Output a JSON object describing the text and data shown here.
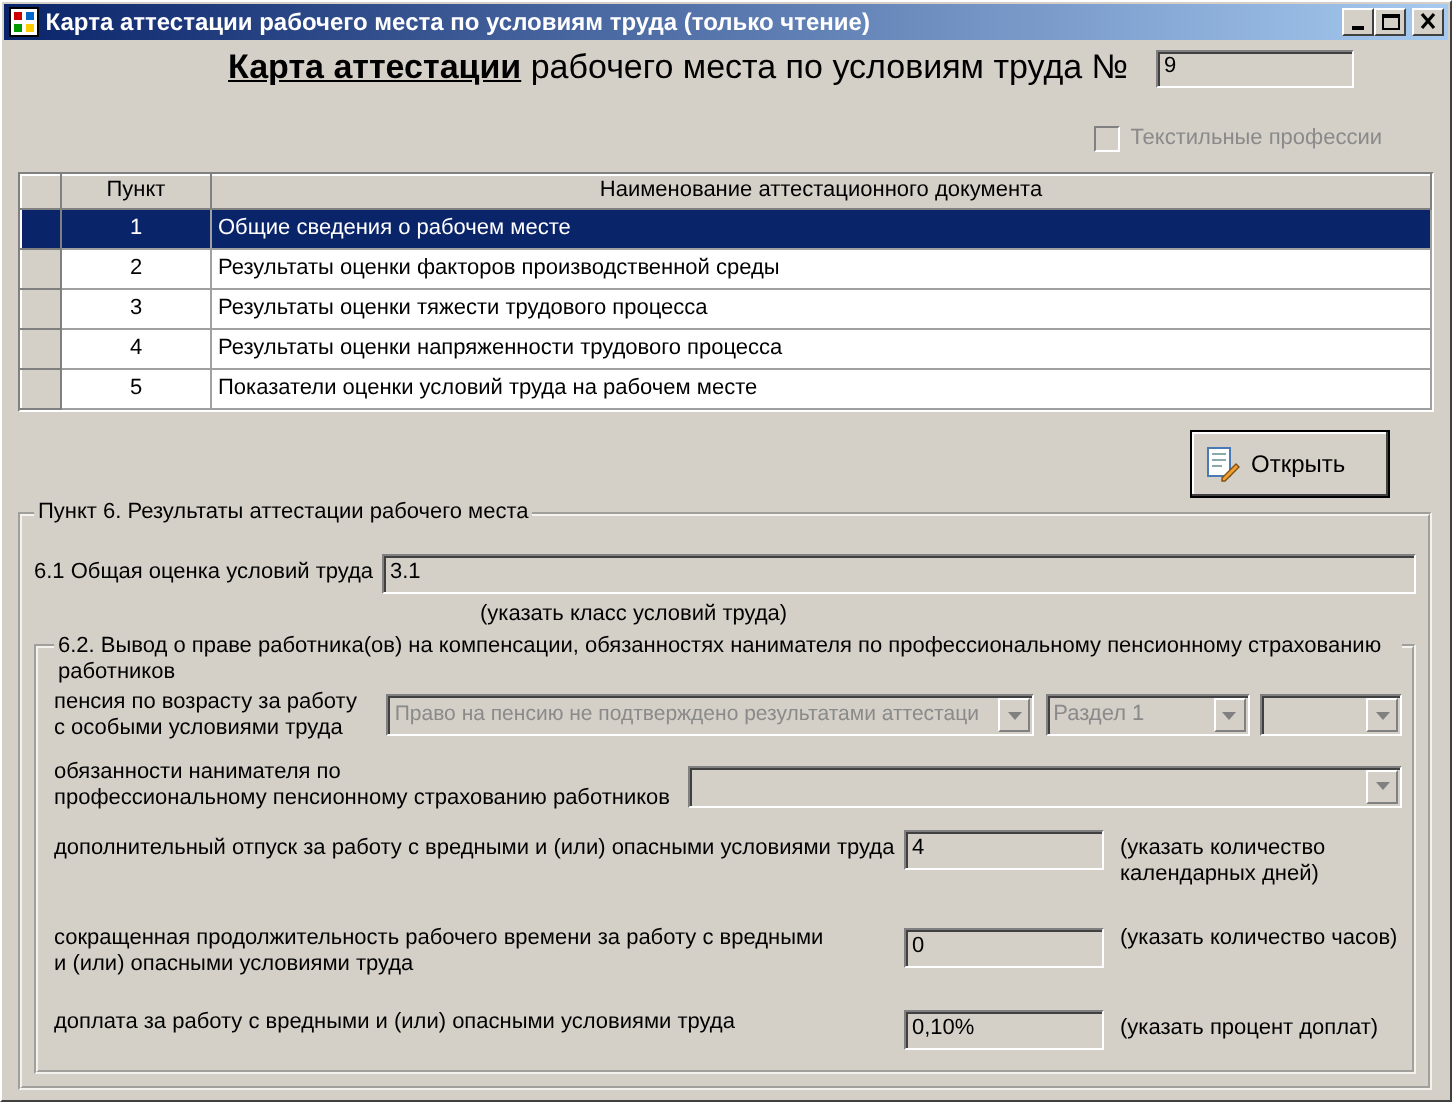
{
  "window": {
    "title": "Карта аттестации рабочего места по условиям труда (только чтение)"
  },
  "heading": {
    "text": "**Карта аттестации** рабочего места по условиям труда №",
    "number": "9"
  },
  "textile_professions": {
    "label": "Текстильные профессии",
    "checked": false,
    "disabled": true
  },
  "documents": {
    "columns": [
      "Пункт",
      "Наименование аттестационного документа"
    ],
    "rows": [
      {
        "number": "1",
        "name": "Общие сведения о рабочем месте",
        "selected": true
      },
      {
        "number": "2",
        "name": "Результаты оценки факторов производственной среды",
        "selected": false
      },
      {
        "number": "3",
        "name": "Результаты оценки тяжести трудового процесса",
        "selected": false
      },
      {
        "number": "4",
        "name": "Результаты оценки напряженности трудового процесса",
        "selected": false
      },
      {
        "number": "5",
        "name": "Показатели оценки условий труда на рабочем месте",
        "selected": false
      }
    ]
  },
  "open_button": {
    "label": "Открыть"
  },
  "section6": {
    "title": "Пункт 6. Результаты аттестации рабочего места",
    "overall": {
      "label": "6.1 Общая оценка условий труда",
      "value": "3.1",
      "hint": "(указать класс условий труда)"
    },
    "conclusion": {
      "title": "6.2. Вывод о праве работника(ов) на компенсации, обязанностях нанимателя по профессиональному пенсионному страхованию работников",
      "pension": {
        "label": "пенсия по возрасту за работу\nс особыми условиями труда",
        "selects": [
          {
            "value": "Право на пенсию не подтверждено результатами аттестаци",
            "disabled": true
          },
          {
            "value": "Раздел 1",
            "disabled": true
          },
          {
            "disabled": true
          }
        ]
      },
      "obligations": {
        "label": "обязанности нанимателя по\nпрофессиональному пенсионному страхованию работников",
        "select": {
          "disabled": true
        }
      },
      "fields": [
        {
          "label": "дополнительный отпуск за работу с вредными и (или) опасными условиями труда",
          "value": "4",
          "hint": "(указать количество\nкалендарных дней)"
        },
        {
          "label": "сокращенная продолжительность рабочего времени за работу с вредными\nи (или) опасными условиями труда",
          "value": "0",
          "hint": "(указать количество часов)"
        },
        {
          "label": "доплата за работу с вредными и (или) опасными условиями труда",
          "value": "0,10%",
          "hint": "(указать процент доплат)"
        }
      ]
    }
  }
}
